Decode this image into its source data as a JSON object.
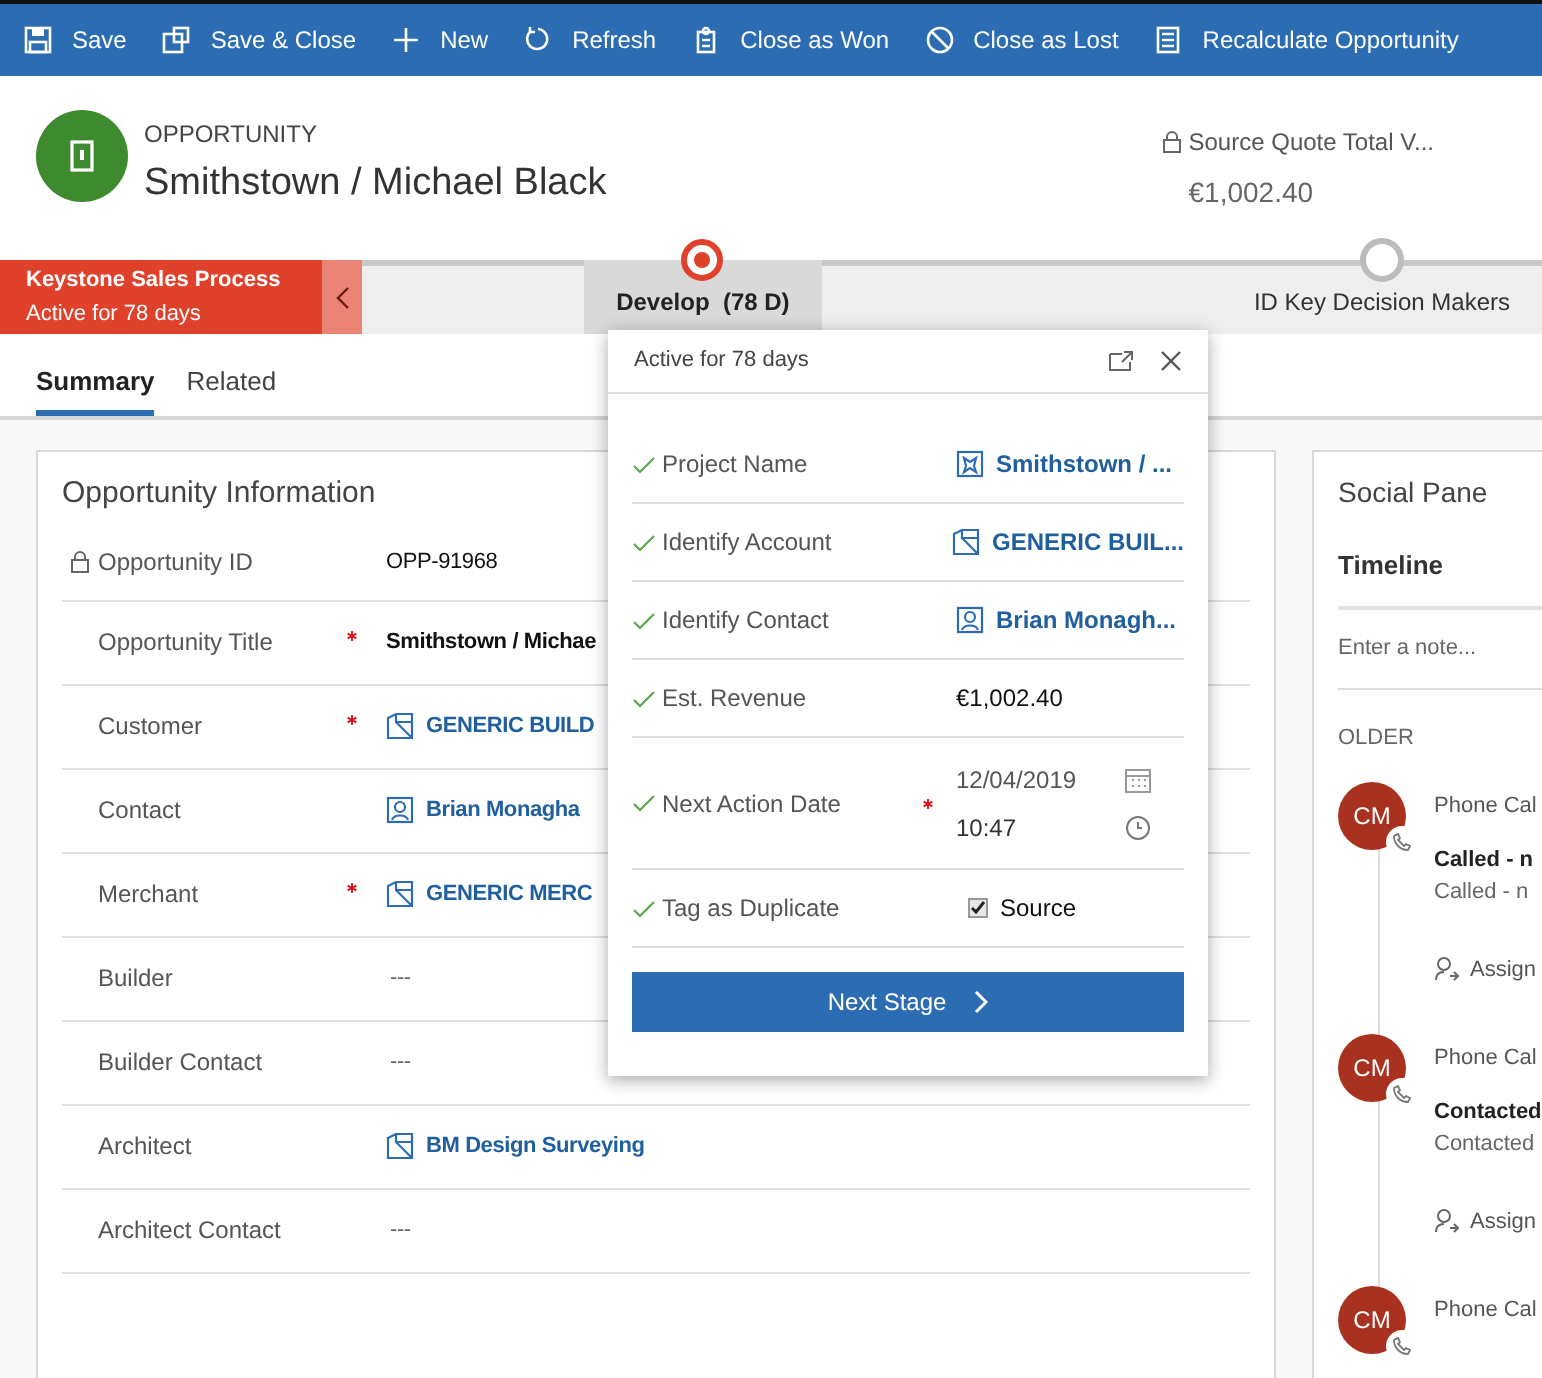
{
  "toolbar": [
    {
      "label": "Save"
    },
    {
      "label": "Save & Close"
    },
    {
      "label": "New"
    },
    {
      "label": "Refresh"
    },
    {
      "label": "Close as Won"
    },
    {
      "label": "Close as Lost"
    },
    {
      "label": "Recalculate Opportunity"
    }
  ],
  "header": {
    "entity": "OPPORTUNITY",
    "title": "Smithstown / Michael Black",
    "summary_field": {
      "label": "Source Quote Total V...",
      "value": "€1,002.40"
    }
  },
  "process": {
    "name": "Keystone Sales Process",
    "duration": "Active for 78 days",
    "stages": [
      {
        "label": "Develop  (78 D)",
        "selected": true
      },
      {
        "label": "ID Key Decision Makers",
        "selected": false
      }
    ]
  },
  "tabs": [
    {
      "label": "Summary",
      "selected": true
    },
    {
      "label": "Related",
      "selected": false
    }
  ],
  "section": {
    "title": "Opportunity Information",
    "fields": [
      {
        "label": "Opportunity ID",
        "locked": true,
        "required": false,
        "kind": "text",
        "value": "OPP-91968"
      },
      {
        "label": "Opportunity Title",
        "locked": false,
        "required": true,
        "kind": "text",
        "value": "Smithstown / Michae"
      },
      {
        "label": "Customer",
        "locked": false,
        "required": true,
        "kind": "account",
        "value": "GENERIC BUILD"
      },
      {
        "label": "Contact",
        "locked": false,
        "required": false,
        "kind": "contact",
        "value": "Brian Monagha"
      },
      {
        "label": "Merchant",
        "locked": false,
        "required": true,
        "kind": "account",
        "value": "GENERIC MERC"
      },
      {
        "label": "Builder",
        "locked": false,
        "required": false,
        "kind": "empty",
        "value": "---"
      },
      {
        "label": "Builder Contact",
        "locked": false,
        "required": false,
        "kind": "empty",
        "value": "---"
      },
      {
        "label": "Architect",
        "locked": false,
        "required": false,
        "kind": "account",
        "value": "BM Design Surveying"
      },
      {
        "label": "Architect Contact",
        "locked": false,
        "required": false,
        "kind": "empty",
        "value": "---"
      }
    ]
  },
  "flyout": {
    "title": "Active for 78 days",
    "steps": [
      {
        "label": "Project Name",
        "completed": true,
        "required": false,
        "kind": "project",
        "value": "Smithstown / ..."
      },
      {
        "label": "Identify Account",
        "completed": true,
        "required": false,
        "kind": "account",
        "value": "GENERIC BUIL..."
      },
      {
        "label": "Identify Contact",
        "completed": true,
        "required": false,
        "kind": "contact",
        "value": "Brian Monagh..."
      },
      {
        "label": "Est. Revenue",
        "completed": true,
        "required": false,
        "kind": "text",
        "value": "€1,002.40"
      },
      {
        "label": "Next Action Date",
        "completed": true,
        "required": true,
        "kind": "datetime",
        "date": "12/04/2019",
        "time": "10:47"
      },
      {
        "label": "Tag as Duplicate",
        "completed": true,
        "required": false,
        "kind": "checkbox",
        "checked": true,
        "value": "Source"
      }
    ],
    "next_button": "Next Stage"
  },
  "social_pane": {
    "title": "Social Pane",
    "tab": "Timeline",
    "note_placeholder": "Enter a note...",
    "group": "OLDER",
    "items": [
      {
        "initials": "CM",
        "type": "Phone Cal",
        "subject": "Called - n",
        "description": "Called - n",
        "action": "Assign"
      },
      {
        "initials": "CM",
        "type": "Phone Cal",
        "subject": "Contacted",
        "description": "Contacted",
        "action": "Assign"
      },
      {
        "initials": "CM",
        "type": "Phone Cal"
      }
    ]
  }
}
